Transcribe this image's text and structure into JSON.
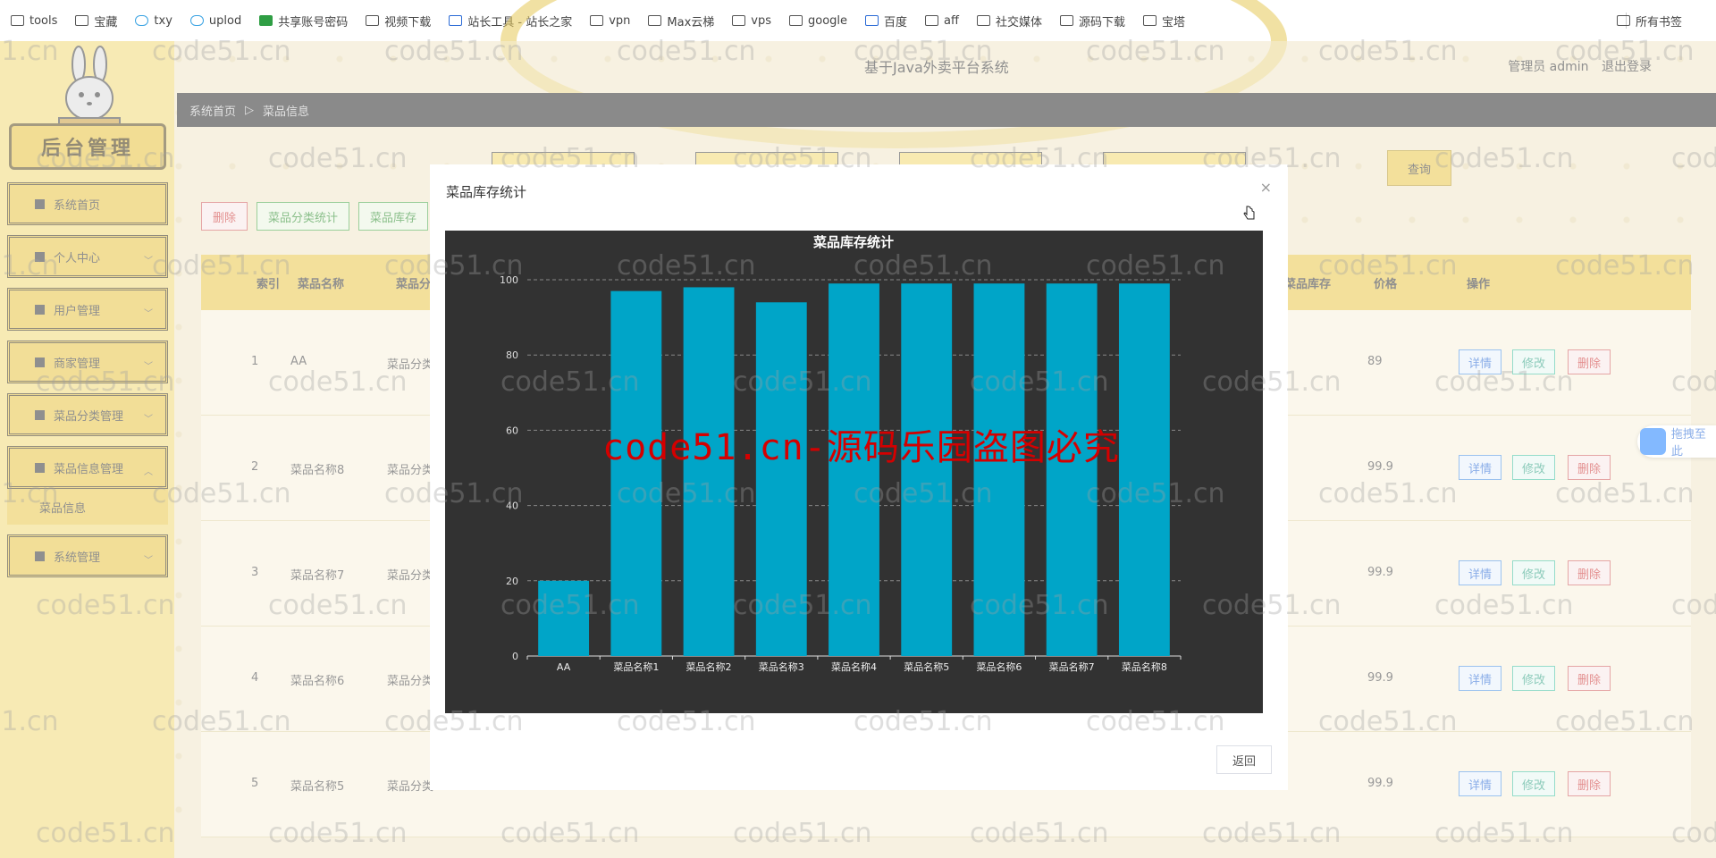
{
  "bookmarks": {
    "items": [
      "tools",
      "宝藏",
      "txy",
      "uplod",
      "共享账号密码",
      "视频下载",
      "站长工具 - 站长之家",
      "vpn",
      "Max云梯",
      "vps",
      "google",
      "百度",
      "aff",
      "社交媒体",
      "源码下载",
      "宝塔"
    ],
    "right": "所有书签"
  },
  "sidebar": {
    "logo": "后台管理",
    "items": [
      {
        "label": "系统首页"
      },
      {
        "label": "个人中心"
      },
      {
        "label": "用户管理"
      },
      {
        "label": "商家管理"
      },
      {
        "label": "菜品分类管理"
      },
      {
        "label": "菜品信息管理"
      },
      {
        "label": "系统管理"
      }
    ],
    "sub_item": "菜品信息"
  },
  "header": {
    "title": "基于Java外卖平台系统",
    "admin": "管理员 admin",
    "logout": "退出登录"
  },
  "breadcrumb": {
    "home": "系统首页",
    "current": "菜品信息"
  },
  "toolbar": {
    "search": "查询",
    "delete": "删除",
    "category_stats": "菜品分类统计",
    "stock_stats": "菜品库存"
  },
  "table": {
    "headers": [
      "索引",
      "菜品名称",
      "菜品分",
      "菜品库存",
      "价格",
      "操作"
    ],
    "rows": [
      {
        "index": "1",
        "name": "AA",
        "category": "菜品分类",
        "price": "89"
      },
      {
        "index": "2",
        "name": "菜品名称8",
        "category": "菜品分类",
        "price": "99.9"
      },
      {
        "index": "3",
        "name": "菜品名称7",
        "category": "菜品分类",
        "price": "99.9"
      },
      {
        "index": "4",
        "name": "菜品名称6",
        "category": "菜品分类",
        "price": "99.9"
      },
      {
        "index": "5",
        "name": "菜品名称5",
        "category": "菜品分类",
        "price": "99.9"
      }
    ],
    "ops": {
      "detail": "详情",
      "edit": "修改",
      "delete": "删除"
    }
  },
  "modal": {
    "title": "菜品库存统计",
    "close": "×",
    "back": "返回"
  },
  "watermark": {
    "red": "code51.cn-源码乐园盗图必究",
    "tile": "code51.cn"
  },
  "side_widget": "拖拽至此",
  "colors": {
    "bar": "#00a5c8",
    "chart_bg": "#323232",
    "sidebar": "#f1d977",
    "accent": "#e9c64a"
  },
  "chart_data": {
    "type": "bar",
    "title": "菜品库存统计",
    "categories": [
      "AA",
      "菜品名称1",
      "菜品名称2",
      "菜品名称3",
      "菜品名称4",
      "菜品名称5",
      "菜品名称6",
      "菜品名称7",
      "菜品名称8"
    ],
    "values": [
      20,
      97,
      98,
      94,
      99,
      99,
      99,
      99,
      99
    ],
    "ylim": [
      0,
      100
    ],
    "yticks": [
      0,
      20,
      40,
      60,
      80,
      100
    ],
    "grid": true
  }
}
